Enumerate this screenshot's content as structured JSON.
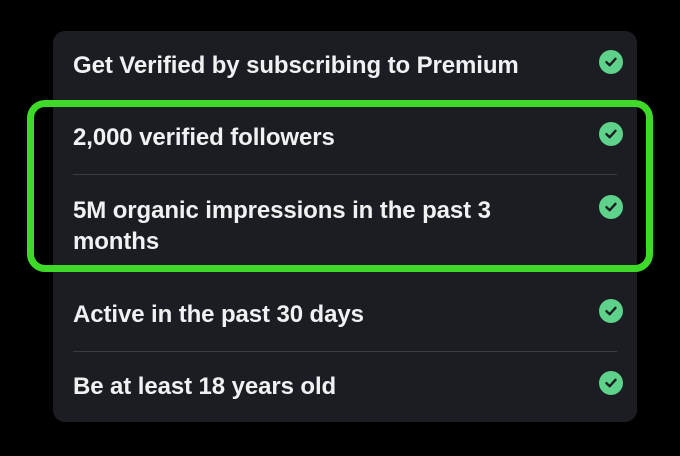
{
  "requirements": [
    {
      "label": "Get Verified by subscribing to Premium",
      "status_icon": "check-circle-icon",
      "met": true
    },
    {
      "label": "2,000 verified followers",
      "status_icon": "check-circle-icon",
      "met": true
    },
    {
      "label": "5M organic impressions in the past 3 months",
      "status_icon": "check-circle-icon",
      "met": true
    },
    {
      "label": "Active in the past 30 days",
      "status_icon": "check-circle-icon",
      "met": true
    },
    {
      "label": "Be at least 18 years old",
      "status_icon": "check-circle-icon",
      "met": true
    }
  ],
  "colors": {
    "background": "#000000",
    "card": "#1c1d22",
    "text": "#eff1f3",
    "check": "#5ed18a",
    "highlight": "#3fd92a"
  }
}
